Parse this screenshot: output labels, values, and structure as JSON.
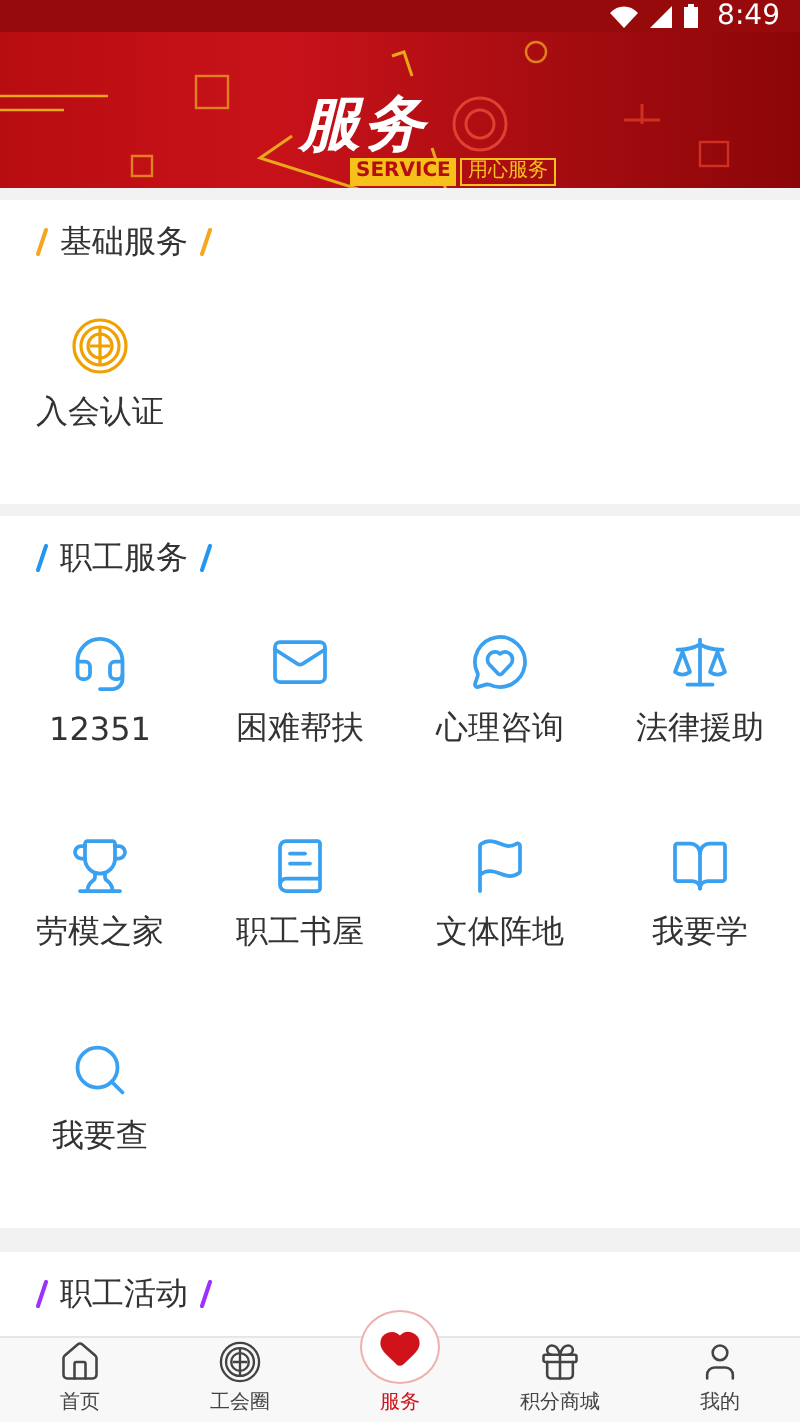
{
  "status_bar": {
    "time": "8:49"
  },
  "banner": {
    "title": "服务",
    "tag": "SERVICE",
    "slogan": "用心服务"
  },
  "sections": [
    {
      "title": "基础服务",
      "color": "#f5a623",
      "items": [
        {
          "label": "入会认证",
          "kind": "emblem"
        }
      ]
    },
    {
      "title": "职工服务",
      "color": "#2196f3",
      "items": [
        {
          "label": "12351",
          "kind": "headset"
        },
        {
          "label": "困难帮扶",
          "kind": "envelope"
        },
        {
          "label": "心理咨询",
          "kind": "heartchat"
        },
        {
          "label": "法律援助",
          "kind": "scale"
        },
        {
          "label": "劳模之家",
          "kind": "trophy"
        },
        {
          "label": "职工书屋",
          "kind": "book"
        },
        {
          "label": "文体阵地",
          "kind": "flag"
        },
        {
          "label": "我要学",
          "kind": "openbook"
        },
        {
          "label": "我要查",
          "kind": "search"
        }
      ]
    },
    {
      "title": "职工活动",
      "color": "#9b30ff"
    }
  ],
  "nav": [
    {
      "label": "首页",
      "kind": "home",
      "selected": false
    },
    {
      "label": "工会圈",
      "kind": "emblem",
      "selected": false
    },
    {
      "label": "服务",
      "kind": "heart",
      "selected": true
    },
    {
      "label": "积分商城",
      "kind": "gift",
      "selected": false
    },
    {
      "label": "我的",
      "kind": "user",
      "selected": false
    }
  ]
}
